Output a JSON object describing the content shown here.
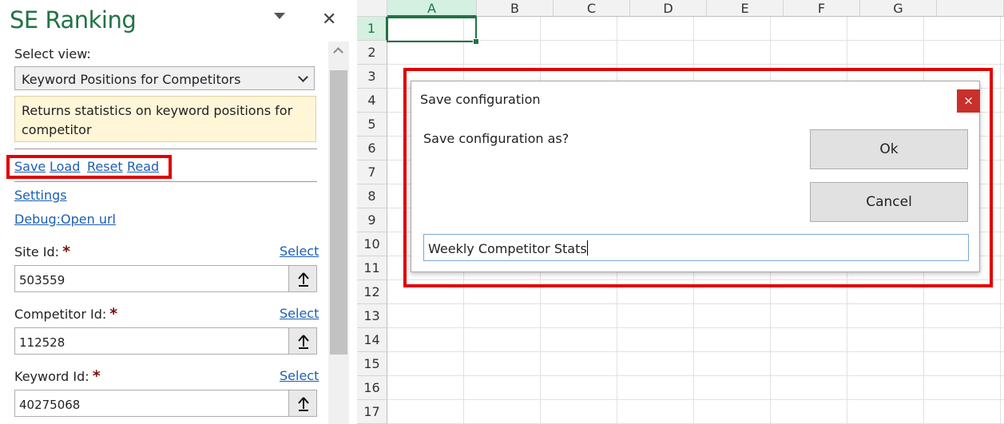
{
  "pane": {
    "title": "SE Ranking",
    "select_view_label": "Select view:",
    "view_value": "Keyword Positions for Competitors",
    "description": "Returns statistics on keyword positions for competitor",
    "links": {
      "save": "Save",
      "load": "Load",
      "reset": "Reset",
      "read": "Read"
    },
    "settings_link": "Settings",
    "debug_link": "Debug:Open url",
    "fields": [
      {
        "label": "Site Id:",
        "select": "Select",
        "value": "503559"
      },
      {
        "label": "Competitor Id:",
        "select": "Select",
        "value": "112528"
      },
      {
        "label": "Keyword Id:",
        "select": "Select",
        "value": "40275068"
      }
    ],
    "close_glyph": "✕",
    "required_mark": "*"
  },
  "sheet": {
    "columns": [
      "A",
      "B",
      "C",
      "D",
      "E",
      "F",
      "G"
    ],
    "rows": [
      "1",
      "2",
      "3",
      "4",
      "5",
      "6",
      "7",
      "8",
      "9",
      "10",
      "11",
      "12",
      "13",
      "14",
      "15",
      "16",
      "17"
    ],
    "selected_cell": "A1",
    "accent": "#217346"
  },
  "dialog": {
    "title": "Save configuration",
    "prompt": "Save configuration as?",
    "ok_label": "Ok",
    "cancel_label": "Cancel",
    "input_value": "Weekly Competitor Stats",
    "close_glyph": "×"
  },
  "colors": {
    "highlight": "#e00000",
    "link": "#1a5fb4",
    "close_red": "#c9302c"
  }
}
